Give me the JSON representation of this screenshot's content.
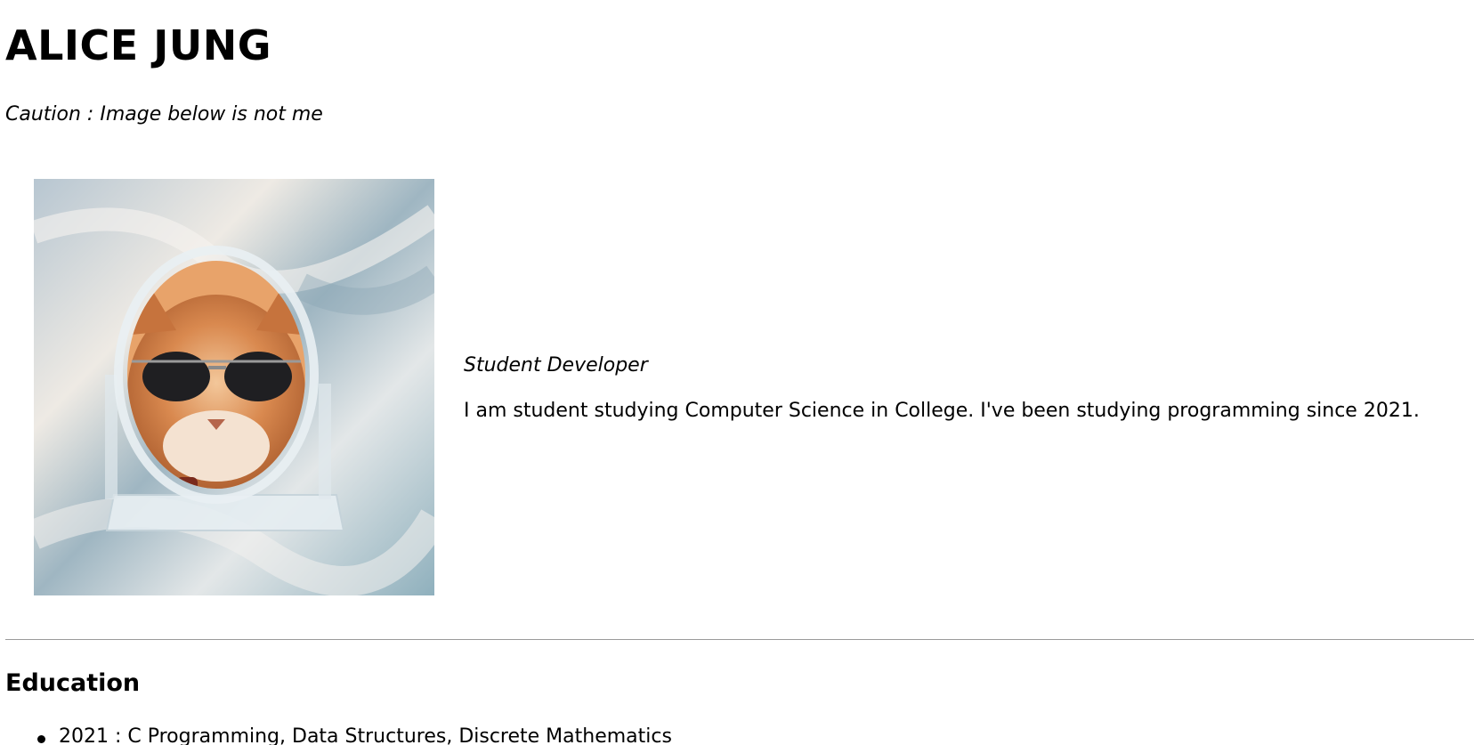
{
  "header": {
    "name": "ALICE JUNG",
    "caution": "Caution : Image below is not me"
  },
  "profile": {
    "photo_icon": "cat-with-sunglasses-in-mirror-photo",
    "role": "Student Developer",
    "bio": "I am student studying Computer Science in College. I've been studying programming since 2021."
  },
  "education": {
    "title": "Education",
    "items": [
      "2021 : C Programming, Data Structures, Discrete Mathematics"
    ]
  }
}
